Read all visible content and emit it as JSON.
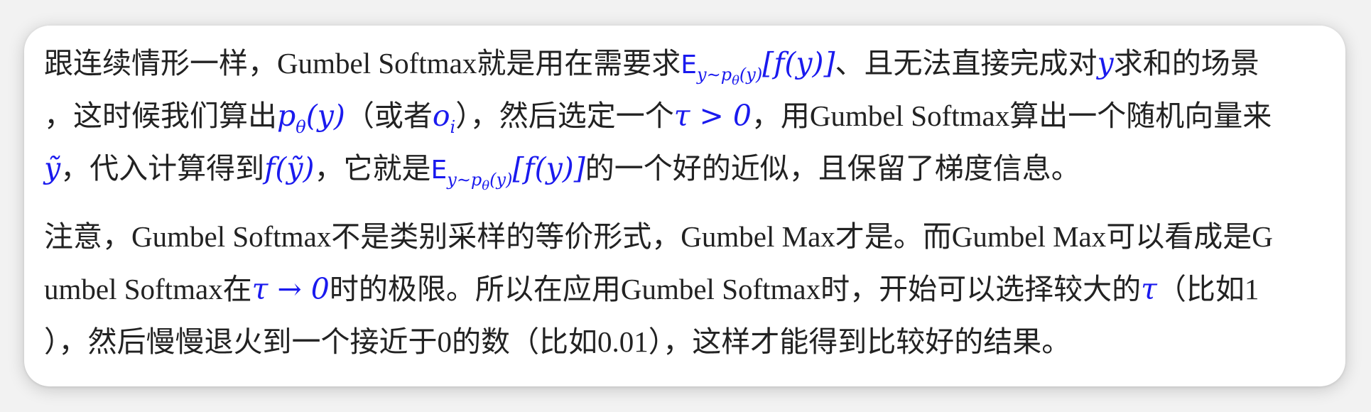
{
  "colors": {
    "text": "#222222",
    "math": "#1a1aee",
    "card_background": "#ffffff",
    "page_background": "#f2f2f2"
  },
  "paragraphs": [
    {
      "lines": [
        {
          "t1": "跟连续情形一样，Gumbel Softmax就是用在需要求",
          "m1": "E",
          "m1_sub": "y∼p",
          "m1_subsub": "θ",
          "m1_subtail": "(y)",
          "m1_tail": "[f(y)]",
          "t2": "、且无法直接完成对",
          "m2": "y",
          "t3": "求和的场景"
        },
        {
          "t1": "，这时候我们算出",
          "m1": "p",
          "m1_sub": "θ",
          "m1_tail": "(y)",
          "t2": "（或者",
          "m2": "o",
          "m2_sub": "i",
          "t3": "），然后选定一个",
          "m3": "τ > 0",
          "t4": "，用Gumbel Softmax算出一个随机向量来"
        },
        {
          "m1": "ỹ",
          "t1": "，代入计算得到",
          "m2": "f(ỹ)",
          "t2": "，它就是",
          "m3": "E",
          "m3_sub": "y∼p",
          "m3_subsub": "θ",
          "m3_subtail": "(y)",
          "m3_tail": "[f(y)]",
          "t3": "的一个好的近似，且保留了梯度信息。"
        }
      ]
    },
    {
      "lines": [
        {
          "t1": "注意，Gumbel Softmax不是类别采样的等价形式，Gumbel Max才是。而Gumbel Max可以看成是G"
        },
        {
          "t1": "umbel Softmax在",
          "m1": "τ → 0",
          "t2": "时的极限。所以在应用Gumbel Softmax时，开始可以选择较大的",
          "m2": "τ",
          "t3": "（比如1"
        },
        {
          "t1": "），然后慢慢退火到一个接近于0的数（比如0.01），这样才能得到比较好的结果。"
        }
      ]
    }
  ]
}
